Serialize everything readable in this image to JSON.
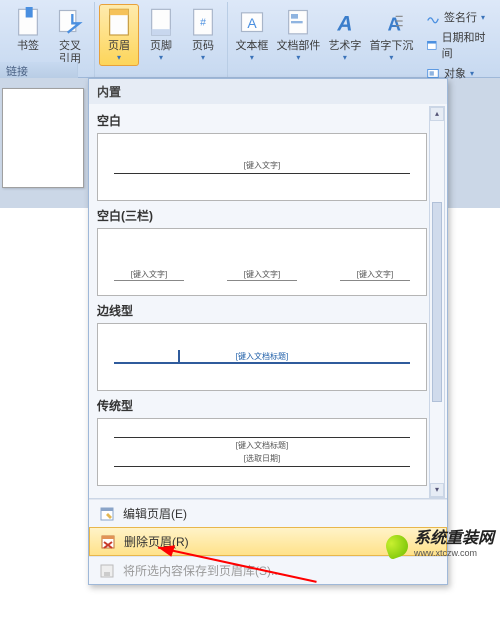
{
  "ribbon": {
    "group1_label": "链接",
    "bookmark": "书签",
    "crossref": "交叉\n引用",
    "header": "页眉",
    "footer": "页脚",
    "pagenum": "页码",
    "textbox": "文本框",
    "docparts": "文档部件",
    "wordart": "艺术字",
    "dropcap": "首字下沉",
    "side_signature": "签名行",
    "side_datetime": "日期和时间",
    "side_object": "对象"
  },
  "doc": {
    "blank": ""
  },
  "dropdown": {
    "section_builtin": "内置",
    "tpl_blank": "空白",
    "tpl_blank_ph": "[键入文字]",
    "tpl_blank3": "空白(三栏)",
    "tpl_blank3_ph": "[键入文字]",
    "tpl_border": "边线型",
    "tpl_border_ph": "[键入文档标题]",
    "tpl_trad": "传统型",
    "tpl_trad_ph1": "[键入文档标题]",
    "tpl_trad_ph2": "[选取日期]",
    "edit_header": "编辑页眉(E)",
    "remove_header": "删除页眉(R)",
    "save_to_gallery": "将所选内容保存到页眉库(S)..."
  },
  "watermark": "系统重装网",
  "watermark_url": "www.xtczw.com"
}
